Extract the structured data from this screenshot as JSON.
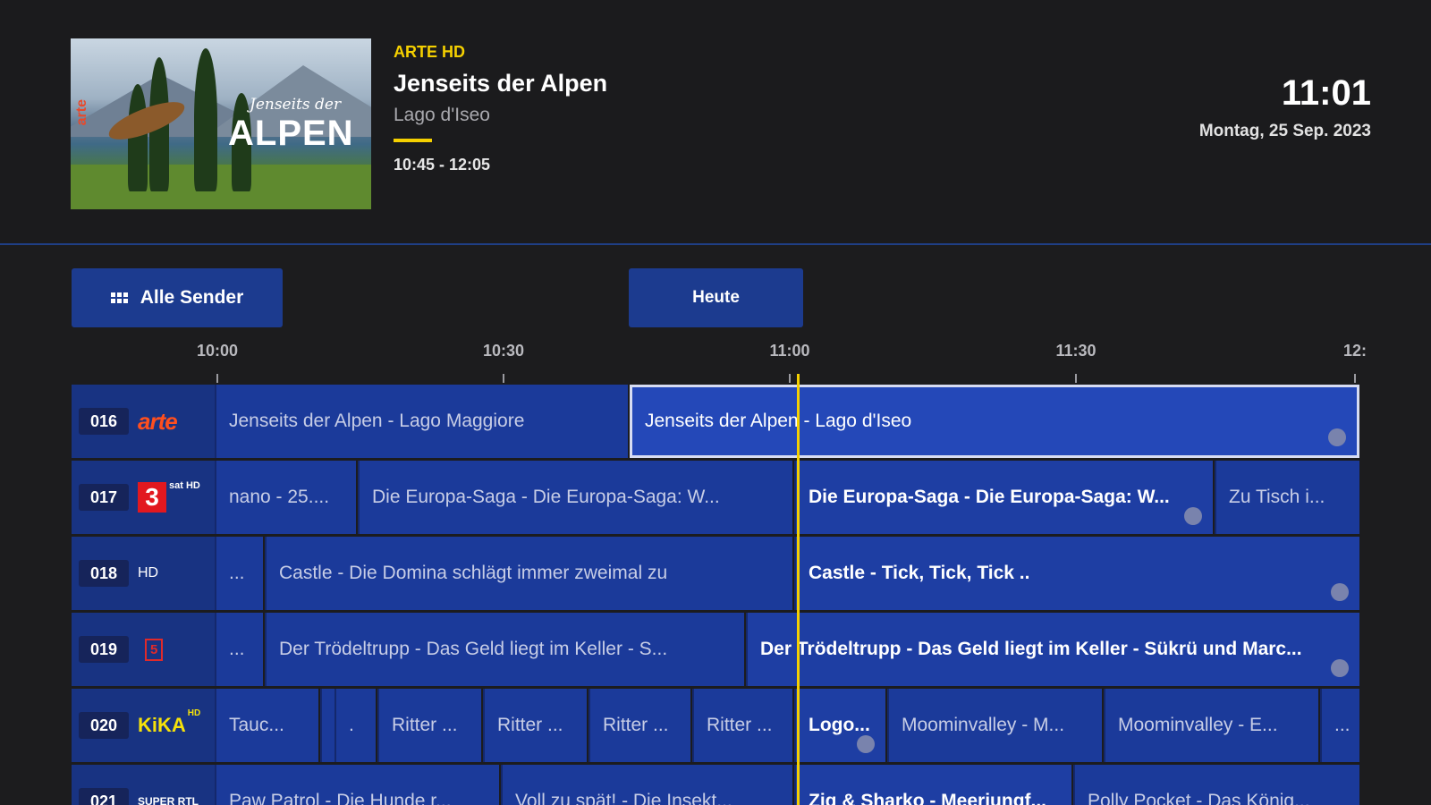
{
  "header": {
    "thumbnail": {
      "logo_text": "arte",
      "title_small": "Jenseits der",
      "title_big": "ALPEN"
    },
    "channel_name": "ARTE HD",
    "program_title": "Jenseits der Alpen",
    "program_subtitle": "Lago d'Iseo",
    "progress": 0.27,
    "program_time": "10:45 - 12:05",
    "clock": "11:01",
    "date": "Montag, 25 Sep. 2023"
  },
  "buttons": {
    "all_channels": "Alle Sender",
    "today": "Heute"
  },
  "timeline": {
    "labels": [
      "10:00",
      "10:30",
      "11:00",
      "11:30",
      "12:"
    ]
  },
  "channels": [
    {
      "number": "016",
      "logo": "arte",
      "logo_text": "arte",
      "programs": [
        {
          "title": "Jenseits der Alpen - Lago Maggiore"
        },
        {
          "title": "Jenseits der Alpen - Lago d'Iseo",
          "selected": true,
          "rec": true
        }
      ]
    },
    {
      "number": "017",
      "logo": "3sat",
      "logo_text": "3",
      "logo_suffix": "sat HD",
      "programs": [
        {
          "title": "nano - 25...."
        },
        {
          "title": "Die Europa-Saga - Die Europa-Saga: W..."
        },
        {
          "title": "Die Europa-Saga - Die Europa-Saga: W...",
          "rec": true
        },
        {
          "title": "Zu Tisch i..."
        }
      ]
    },
    {
      "number": "018",
      "logo": "kabeleins",
      "logo_suffix": "HD",
      "programs": [
        {
          "title": "..."
        },
        {
          "title": "Castle - Die Domina schlägt immer zweimal zu"
        },
        {
          "title": "Castle - Tick, Tick, Tick ..",
          "rec": true
        }
      ]
    },
    {
      "number": "019",
      "logo": "tele5",
      "logo_text": "5",
      "programs": [
        {
          "title": "..."
        },
        {
          "title": "Der Trödeltrupp - Das Geld liegt im Keller - S..."
        },
        {
          "title": "Der Trödeltrupp - Das Geld liegt im Keller - Sükrü und Marc...",
          "rec": true
        }
      ]
    },
    {
      "number": "020",
      "logo": "kika",
      "logo_text": "KiKA",
      "logo_suffix": "HD",
      "programs": [
        {
          "title": "Tauc..."
        },
        {
          "title": ""
        },
        {
          "title": "."
        },
        {
          "title": "Ritter ..."
        },
        {
          "title": "Ritter ..."
        },
        {
          "title": "Ritter ..."
        },
        {
          "title": "Ritter ..."
        },
        {
          "title": "Logo...",
          "rec": true
        },
        {
          "title": "Moominvalley - M..."
        },
        {
          "title": "Moominvalley - E..."
        },
        {
          "title": "..."
        }
      ]
    },
    {
      "number": "021",
      "logo": "superrtl",
      "logo_text": "SUPER RTL",
      "programs": [
        {
          "title": "Paw Patrol - Die Hunde r..."
        },
        {
          "title": "Voll zu spät! - Die Insekt..."
        },
        {
          "title": "Zig & Sharko - Meerjungf..."
        },
        {
          "title": "Polly Pocket - Das König..."
        }
      ]
    }
  ]
}
